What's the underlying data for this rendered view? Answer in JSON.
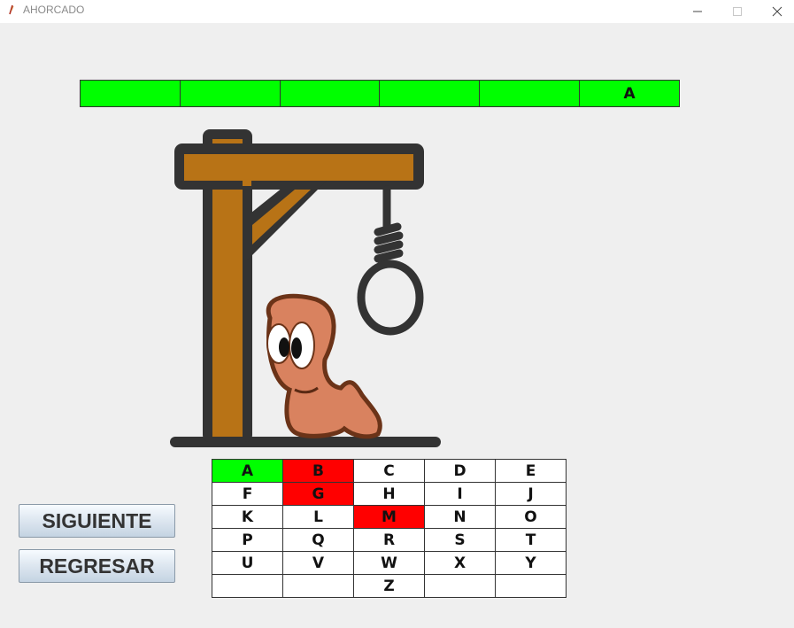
{
  "window": {
    "title": "AHORCADO",
    "minimize_glyph": "—",
    "maximize_glyph": "☐",
    "close_glyph": "✕"
  },
  "word": {
    "slots": [
      "",
      "",
      "",
      "",
      "",
      "A"
    ],
    "slot_color": "#00ff00"
  },
  "image": {
    "description_icon": "hangman-gallows-worm"
  },
  "keyboard": {
    "keys": [
      {
        "letter": "A",
        "state": "hit"
      },
      {
        "letter": "B",
        "state": "miss"
      },
      {
        "letter": "C",
        "state": "none"
      },
      {
        "letter": "D",
        "state": "none"
      },
      {
        "letter": "E",
        "state": "none"
      },
      {
        "letter": "F",
        "state": "none"
      },
      {
        "letter": "G",
        "state": "miss"
      },
      {
        "letter": "H",
        "state": "none"
      },
      {
        "letter": "I",
        "state": "none"
      },
      {
        "letter": "J",
        "state": "none"
      },
      {
        "letter": "K",
        "state": "none"
      },
      {
        "letter": "L",
        "state": "none"
      },
      {
        "letter": "M",
        "state": "miss"
      },
      {
        "letter": "N",
        "state": "none"
      },
      {
        "letter": "O",
        "state": "none"
      },
      {
        "letter": "P",
        "state": "none"
      },
      {
        "letter": "Q",
        "state": "none"
      },
      {
        "letter": "R",
        "state": "none"
      },
      {
        "letter": "S",
        "state": "none"
      },
      {
        "letter": "T",
        "state": "none"
      },
      {
        "letter": "U",
        "state": "none"
      },
      {
        "letter": "V",
        "state": "none"
      },
      {
        "letter": "W",
        "state": "none"
      },
      {
        "letter": "X",
        "state": "none"
      },
      {
        "letter": "Y",
        "state": "none"
      },
      {
        "letter": "",
        "state": "none"
      },
      {
        "letter": "",
        "state": "none"
      },
      {
        "letter": "Z",
        "state": "none"
      },
      {
        "letter": "",
        "state": "none"
      },
      {
        "letter": "",
        "state": "none"
      }
    ],
    "hit_color": "#00ff00",
    "miss_color": "#ff0000"
  },
  "buttons": {
    "next_label": "SIGUIENTE",
    "back_label": "REGRESAR"
  }
}
